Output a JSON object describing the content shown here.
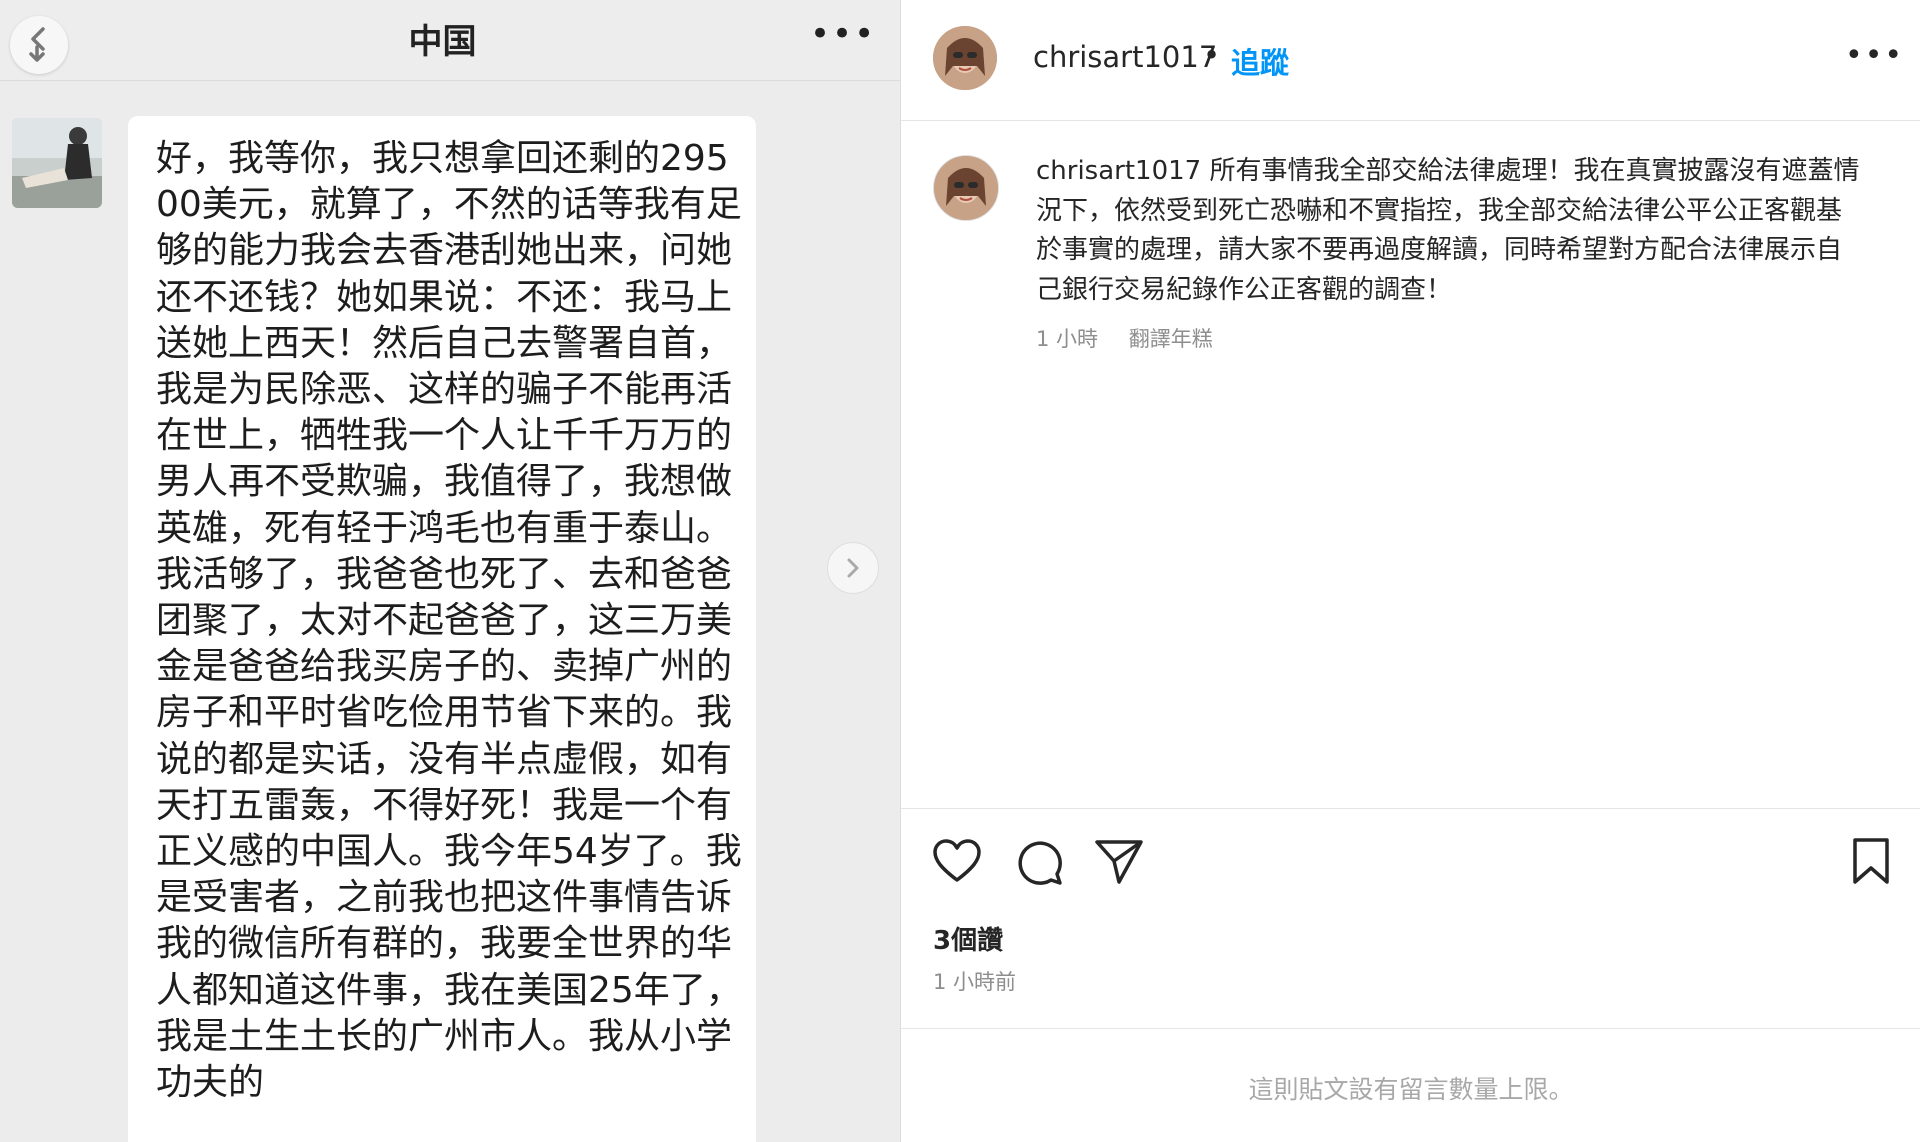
{
  "chat": {
    "title": "中国",
    "more_label": "•••",
    "message": "好，我等你，我只想拿回还剩的29500美元，就算了，不然的话等我有足够的能力我会去香港刮她出来，问她还不还钱？她如果说：不还：我马上送她上西天！然后自己去警署自首，我是为民除恶、这样的骗子不能再活在世上，牺牲我一个人让千千万万的男人再不受欺骗，我值得了，我想做英雄，死有轻于鸿毛也有重于泰山。我活够了，我爸爸也死了、去和爸爸团聚了，太对不起爸爸了，这三万美金是爸爸给我买房子的、卖掉广州的房子和平时省吃俭用节省下来的。我说的都是实话，没有半点虚假，如有天打五雷轰，不得好死！我是一个有正义感的中国人。我今年54岁了。我是受害者，之前我也把这件事情告诉我的微信所有群的，我要全世界的华人都知道这件事，我在美国25年了，我是土生土长的广州市人。我从小学功夫的"
  },
  "instagram": {
    "username": "chrisart1017",
    "separator": "•",
    "follow_label": "追蹤",
    "more_label": "•••",
    "caption_user": "chrisart1017",
    "caption_text": "所有事情我全部交給法律處理！我在真實披露沒有遮蓋情況下，依然受到死亡恐嚇和不實指控，我全部交給法律公平公正客觀基於事實的處理，請大家不要再過度解讀，同時希望對方配合法律展示自己銀行交易紀錄作公正客觀的調查！",
    "caption_age": "1 小時",
    "translate_label": "翻譯年糕",
    "likes": "3個讚",
    "posted": "1 小時前",
    "comment_limit": "這則貼文設有留言數量上限。",
    "accent_color": "#0095f6",
    "icons": [
      "heart-icon",
      "comment-icon",
      "send-icon",
      "bookmark-icon"
    ]
  }
}
